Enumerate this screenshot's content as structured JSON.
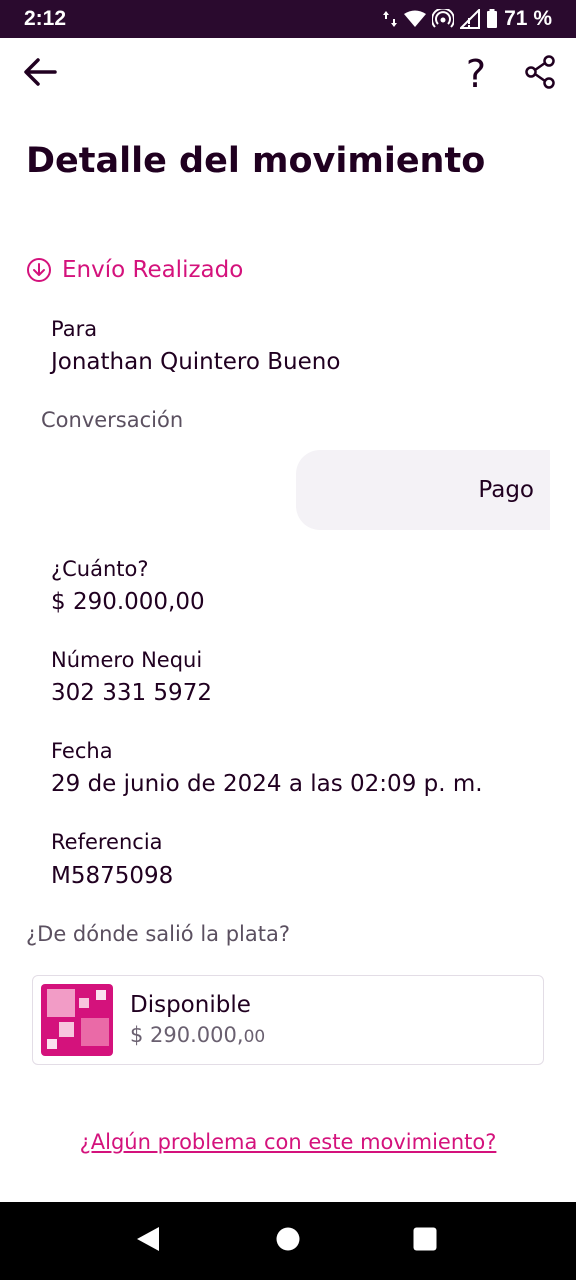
{
  "status_bar": {
    "time": "2:12",
    "battery": "71 %",
    "icons": [
      "data-arrows-icon",
      "wifi-icon",
      "hotspot-icon",
      "signal-icon",
      "battery-icon"
    ]
  },
  "app_bar": {
    "back_icon": "arrow-left-icon",
    "help_label": "?",
    "share_icon": "share-icon"
  },
  "title": "Detalle del movimiento",
  "status": {
    "icon": "arrow-down-circle-icon",
    "text": "Envío Realizado",
    "color": "#d4127c"
  },
  "fields": {
    "recipient_label": "Para",
    "recipient_value": "Jonathan Quintero Bueno",
    "conversation_label": "Conversación",
    "conversation_message": "Pago",
    "amount_label": "¿Cuánto?",
    "amount_value": "$ 290.000,00",
    "nequi_label": "Número Nequi",
    "nequi_value": "302 331 5972",
    "date_label": "Fecha",
    "date_value": "29 de junio de 2024 a las 02:09 p. m.",
    "reference_label": "Referencia",
    "reference_value": "M5875098"
  },
  "source": {
    "label": "¿De dónde salió la plata?",
    "account_name": "Disponible",
    "account_amount_main": "$ 290.000,",
    "account_amount_cents": "00",
    "logo_icon": "nequi-squares-logo",
    "brand_color": "#d4127c"
  },
  "problem_link": "¿Algún problema con este movimiento?",
  "nav_bar": {
    "back_icon": "triangle-back-icon",
    "home_icon": "circle-home-icon",
    "recents_icon": "square-recents-icon"
  }
}
